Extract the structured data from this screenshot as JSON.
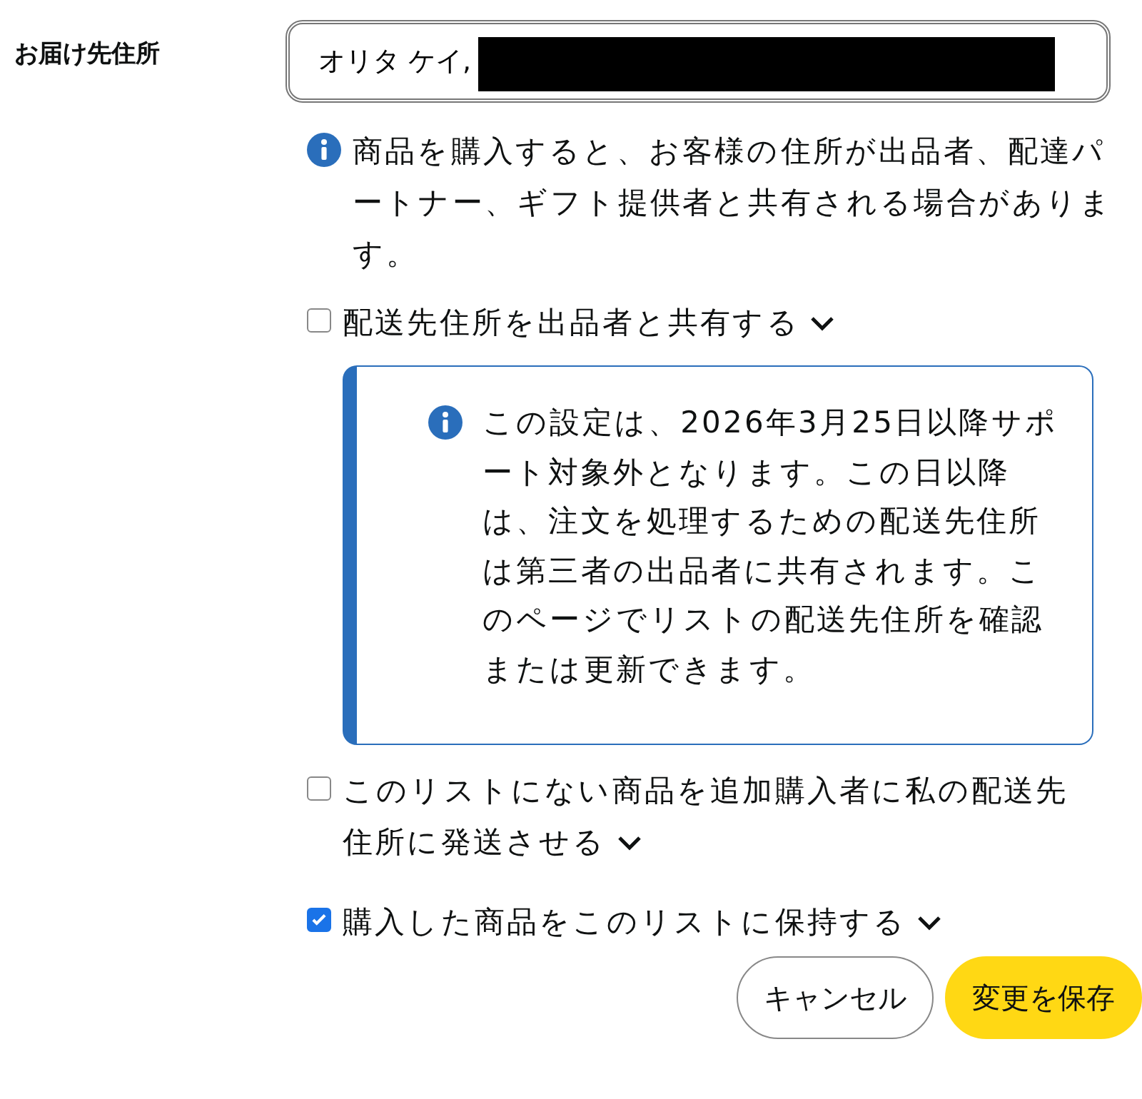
{
  "address": {
    "label": "お届け先住所",
    "value": "オリタ ケイ,",
    "redacted": true
  },
  "info": {
    "text": "商品を購入すると、お客様の住所が出品者、配達パートナー、ギフト提供者と共有される場合があります。"
  },
  "options": [
    {
      "label": "配送先住所を出品者と共有する",
      "checked": false,
      "notice": "この設定は、2026年3月25日以降サポート対象外となります。この日以降は、注文を処理するための配送先住所は第三者の出品者に共有されます。このページでリストの配送先住所を確認または更新できます。"
    },
    {
      "label": "このリストにない商品を追加購入者に私の配送先住所に発送させる",
      "checked": false
    },
    {
      "label": "購入した商品をこのリストに保持する",
      "checked": true
    }
  ],
  "buttons": [
    {
      "label": "キャンセル",
      "kind": "secondary"
    },
    {
      "label": "変更を保存",
      "kind": "primary"
    }
  ]
}
